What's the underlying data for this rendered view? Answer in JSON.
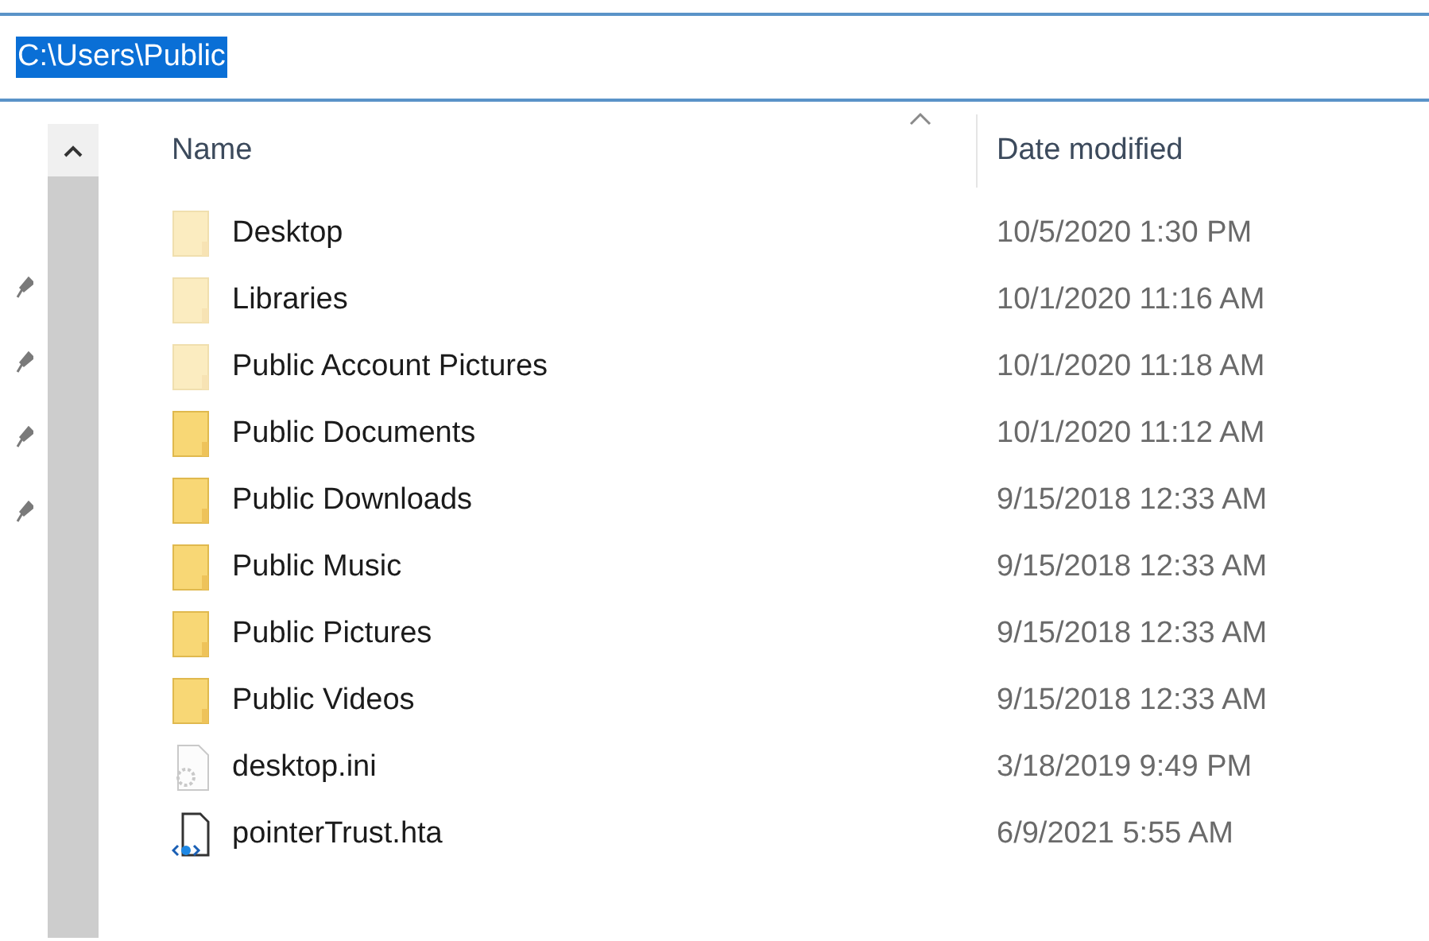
{
  "address_bar": {
    "value": "C:\\Users\\Public",
    "selected": true
  },
  "columns": [
    {
      "label": "Name",
      "sorted": true
    },
    {
      "label": "Date modified",
      "sorted": false
    }
  ],
  "files": [
    {
      "name": "Desktop",
      "kind": "folder",
      "hidden": true,
      "date_modified": "10/5/2020 1:30 PM"
    },
    {
      "name": "Libraries",
      "kind": "folder",
      "hidden": true,
      "date_modified": "10/1/2020 11:16 AM"
    },
    {
      "name": "Public Account Pictures",
      "kind": "folder",
      "hidden": true,
      "date_modified": "10/1/2020 11:18 AM"
    },
    {
      "name": "Public Documents",
      "kind": "folder",
      "hidden": false,
      "date_modified": "10/1/2020 11:12 AM"
    },
    {
      "name": "Public Downloads",
      "kind": "folder",
      "hidden": false,
      "date_modified": "9/15/2018 12:33 AM"
    },
    {
      "name": "Public Music",
      "kind": "folder",
      "hidden": false,
      "date_modified": "9/15/2018 12:33 AM"
    },
    {
      "name": "Public Pictures",
      "kind": "folder",
      "hidden": false,
      "date_modified": "9/15/2018 12:33 AM"
    },
    {
      "name": "Public Videos",
      "kind": "folder",
      "hidden": false,
      "date_modified": "9/15/2018 12:33 AM"
    },
    {
      "name": "desktop.ini",
      "kind": "settings-file",
      "hidden": true,
      "date_modified": "3/18/2019 9:49 PM"
    },
    {
      "name": "pointerTrust.hta",
      "kind": "hta-file",
      "hidden": false,
      "date_modified": "6/9/2021 5:55 AM"
    }
  ]
}
